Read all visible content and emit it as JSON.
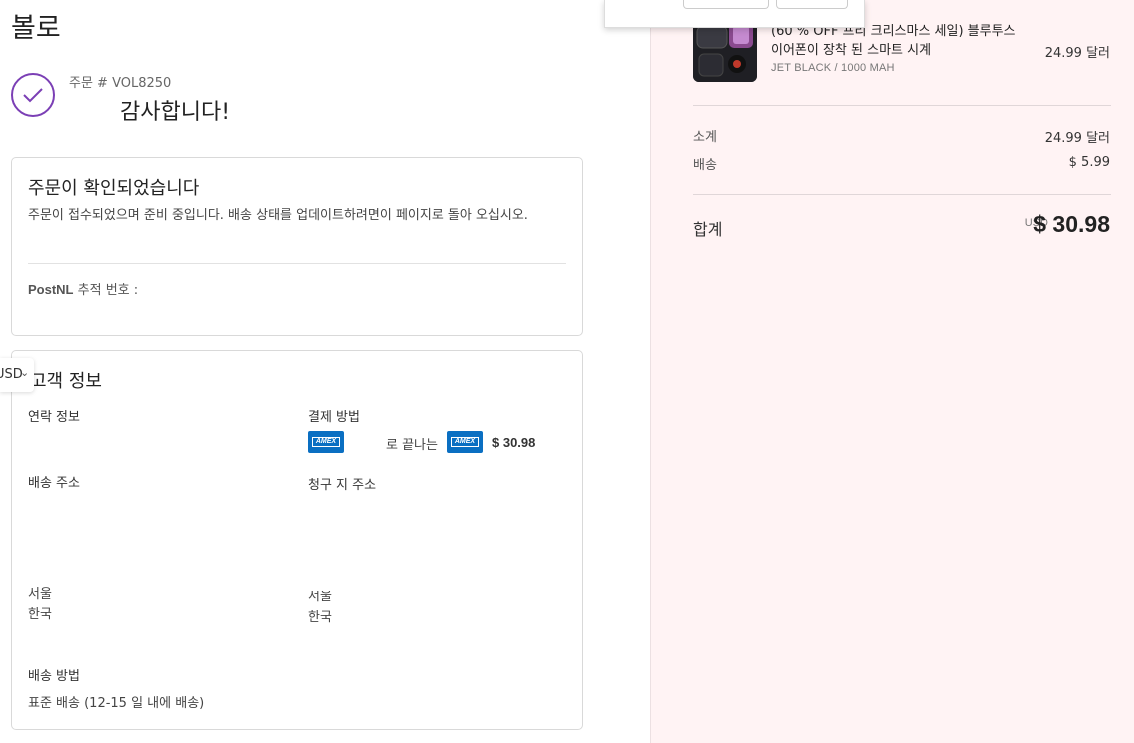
{
  "store": {
    "name": "볼로"
  },
  "order": {
    "number": "주문 # VOL8250",
    "thanks": "감사합니다!"
  },
  "confirm": {
    "title": "주문이 확인되었습니다",
    "description": "주문이 접수되었으며 준비 중입니다. 배송 상태를 업데이트하려면이 페이지로 돌아 오십시오.",
    "tracking_carrier": "PostNL",
    "tracking_label": "추적 번호 :"
  },
  "customer": {
    "title": "고객 정보",
    "contact_label": "연락 정보",
    "payment_label": "결제 방법",
    "payment_card_icon": "amex-card-icon",
    "payment_ending_text": "로 끝나는",
    "payment_amount": "$ 30.98",
    "shipping_address_label": "배송 주소",
    "billing_address_label": "청구 지 주소",
    "shipping_city": "서울",
    "shipping_country": "한국",
    "billing_city": "서울",
    "billing_country": "한국",
    "shipping_method_label": "배송 방법",
    "shipping_method_value": "표준 배송 (12-15 일 내에 배송)"
  },
  "currency_selector": {
    "value": "USD",
    "icon": "chevron-down-icon"
  },
  "summary": {
    "product": {
      "title": "(60 % OFF 프리 크리스마스 세일) 블루투스 이어폰이 장착 된 스마트 시계",
      "variant": "JET BLACK / 1000 MAH",
      "price": "24.99 달러"
    },
    "subtotal_label": "소계",
    "subtotal_value": "24.99 달러",
    "shipping_label": "배송",
    "shipping_value": "$ 5.99",
    "total_label": "합계",
    "total_currency": "USD",
    "total_value": "$ 30.98"
  },
  "colors": {
    "accent": "#7b3fb5",
    "amex": "#0a6fc2",
    "sidebar_bg": "#fff3f4"
  }
}
